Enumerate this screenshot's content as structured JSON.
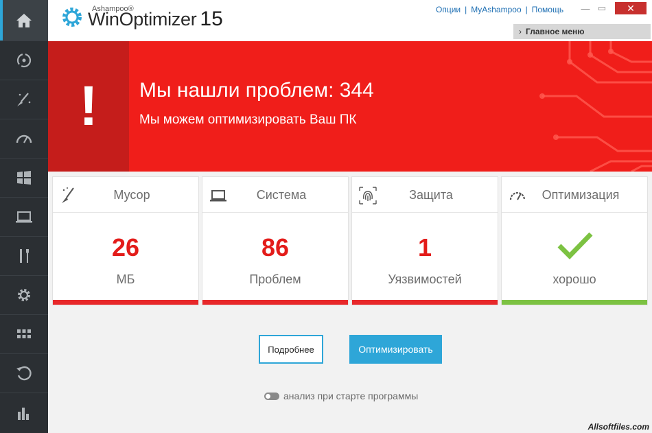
{
  "header": {
    "brand": "Ashampoo®",
    "app_name": "WinOptimizer",
    "version": "15",
    "links": [
      "Опции",
      "MyAshampoo",
      "Помощь"
    ],
    "main_menu": "Главное меню"
  },
  "window_controls": {
    "minimize": "—",
    "maximize": "▭",
    "close": "✕"
  },
  "sidebar": {
    "items": [
      {
        "icon": "home-icon",
        "active": true
      },
      {
        "icon": "refresh-cycle-icon"
      },
      {
        "icon": "magic-broom-icon"
      },
      {
        "icon": "speedometer-icon"
      },
      {
        "icon": "windows-icon"
      },
      {
        "icon": "laptop-icon"
      },
      {
        "icon": "tools-icon"
      },
      {
        "icon": "gear-icon"
      },
      {
        "icon": "grid-icon"
      },
      {
        "icon": "restore-icon"
      },
      {
        "icon": "statistics-icon"
      }
    ]
  },
  "banner": {
    "title": "Мы нашли проблем: 344",
    "subtitle": "Мы можем оптимизировать Ваш ПК",
    "color": "#f01e1a"
  },
  "cards": [
    {
      "title": "Мусор",
      "value": "26",
      "unit": "МБ",
      "icon": "broom-icon",
      "status": "bad"
    },
    {
      "title": "Система",
      "value": "86",
      "unit": "Проблем",
      "icon": "laptop-icon",
      "status": "bad"
    },
    {
      "title": "Защита",
      "value": "1",
      "unit": "Уязвимостей",
      "icon": "fingerprint-icon",
      "status": "bad"
    },
    {
      "title": "Оптимизация",
      "value": "",
      "unit": "хорошо",
      "icon": "speedometer-icon",
      "status": "good"
    }
  ],
  "colors": {
    "bad": "#e8282a",
    "good": "#7cc242",
    "accent": "#2ea6d8"
  },
  "buttons": {
    "details": "Подробнее",
    "optimize": "Оптимизировать"
  },
  "toggle": {
    "label": "анализ при старте программы",
    "on": false
  },
  "watermark": "Allsoftfiles.com"
}
